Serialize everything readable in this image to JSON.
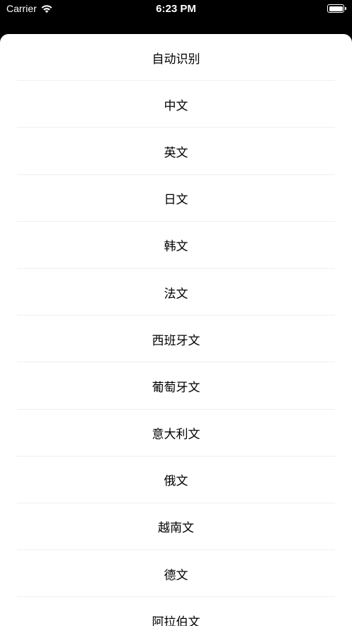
{
  "status_bar": {
    "carrier": "Carrier",
    "time": "6:23 PM",
    "wifi_icon": "wifi-icon",
    "battery_icon": "battery-icon",
    "battery_level": 1.0
  },
  "languages": [
    {
      "label": "自动识别"
    },
    {
      "label": "中文"
    },
    {
      "label": "英文"
    },
    {
      "label": "日文"
    },
    {
      "label": "韩文"
    },
    {
      "label": "法文"
    },
    {
      "label": "西班牙文"
    },
    {
      "label": "葡萄牙文"
    },
    {
      "label": "意大利文"
    },
    {
      "label": "俄文"
    },
    {
      "label": "越南文"
    },
    {
      "label": "德文"
    },
    {
      "label": "阿拉伯文"
    }
  ],
  "colors": {
    "background": "#000000",
    "sheet": "#ffffff",
    "separator": "#efefef",
    "text": "#000000"
  }
}
